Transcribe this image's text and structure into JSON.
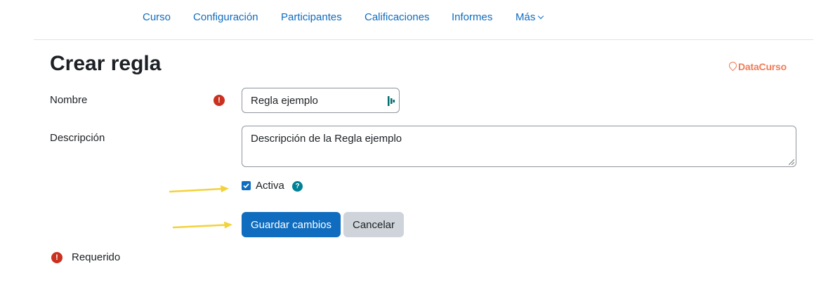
{
  "nav": {
    "items": [
      "Curso",
      "Configuración",
      "Participantes",
      "Calificaciones",
      "Informes"
    ],
    "more_label": "Más"
  },
  "header": {
    "title": "Crear regla",
    "brand": "DataCurso"
  },
  "form": {
    "name_label": "Nombre",
    "name_value": "Regla ejemplo",
    "description_label": "Descripción",
    "description_value": "Descripción de la Regla ejemplo",
    "active_label": "Activa",
    "active_checked": true,
    "required_icon": "!",
    "help_icon": "?"
  },
  "actions": {
    "save_label": "Guardar cambios",
    "cancel_label": "Cancelar"
  },
  "footer": {
    "required_label": "Requerido"
  },
  "colors": {
    "link": "#0f6cbf",
    "primary": "#0f6cbf",
    "secondary": "#ced4da",
    "required": "#ca3120",
    "help": "#008196",
    "brand": "#f07c57",
    "arrow": "#f3d23a"
  }
}
